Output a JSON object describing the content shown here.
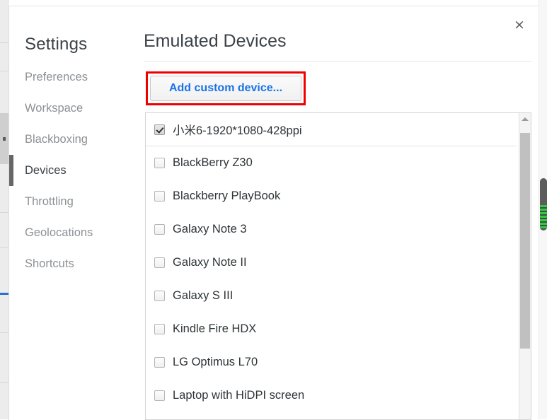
{
  "window": {
    "close_label": "×"
  },
  "sidebar": {
    "title": "Settings",
    "items": [
      {
        "label": "Preferences",
        "selected": false
      },
      {
        "label": "Workspace",
        "selected": false
      },
      {
        "label": "Blackboxing",
        "selected": false
      },
      {
        "label": "Devices",
        "selected": true
      },
      {
        "label": "Throttling",
        "selected": false
      },
      {
        "label": "Geolocations",
        "selected": false
      },
      {
        "label": "Shortcuts",
        "selected": false
      }
    ]
  },
  "main": {
    "title": "Emulated Devices",
    "add_device_label": "Add custom device...",
    "highlight_color": "#ee0000",
    "accent_color": "#1a73e8",
    "devices": [
      {
        "name": "小米6-1920*1080-428ppi",
        "checked": true,
        "custom": true
      },
      {
        "name": "BlackBerry Z30",
        "checked": false,
        "custom": false
      },
      {
        "name": "Blackberry PlayBook",
        "checked": false,
        "custom": false
      },
      {
        "name": "Galaxy Note 3",
        "checked": false,
        "custom": false
      },
      {
        "name": "Galaxy Note II",
        "checked": false,
        "custom": false
      },
      {
        "name": "Galaxy S III",
        "checked": false,
        "custom": false
      },
      {
        "name": "Kindle Fire HDX",
        "checked": false,
        "custom": false
      },
      {
        "name": "LG Optimus L70",
        "checked": false,
        "custom": false
      },
      {
        "name": "Laptop with HiDPI screen",
        "checked": false,
        "custom": false
      }
    ]
  }
}
